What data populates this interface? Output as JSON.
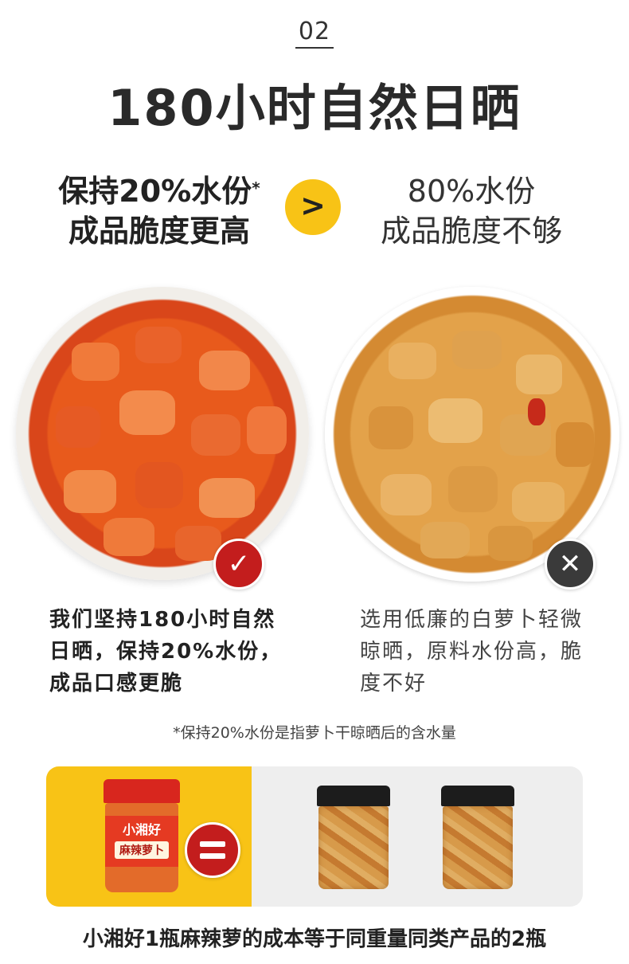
{
  "section_number": "02",
  "title": "180小时自然日晒",
  "comparison": {
    "left_line1": "保持20%水份",
    "left_asterisk": "*",
    "left_line2": "成品脆度更高",
    "operator": ">",
    "right_line1": "80%水份",
    "right_line2": "成品脆度不够"
  },
  "marks": {
    "ok_icon": "check-icon",
    "no_icon": "close-icon",
    "ok_color": "#c31d1d",
    "no_color": "#3a3a3a"
  },
  "descriptions": {
    "left": "我们坚持180小时自然日晒，保持20%水份，成品口感更脆",
    "right": "选用低廉的白萝卜轻微晾晒，原料水份高，脆度不好"
  },
  "footnote": "*保持20%水份是指萝卜干晾晒后的含水量",
  "jar_label": {
    "brand": "小湘好",
    "product": "麻辣萝卜"
  },
  "bottom_text": "小湘好1瓶麻辣萝的成本等于同重量同类产品的2瓶",
  "colors": {
    "accent_yellow": "#f8c316",
    "accent_red": "#c31d1d"
  }
}
